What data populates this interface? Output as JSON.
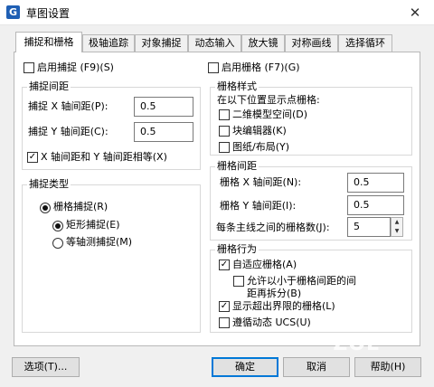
{
  "window": {
    "title": "草图设置",
    "app_icon": "G",
    "close_glyph": "✕"
  },
  "tabs": [
    {
      "label": "捕捉和栅格"
    },
    {
      "label": "极轴追踪"
    },
    {
      "label": "对象捕捉"
    },
    {
      "label": "动态输入"
    },
    {
      "label": "放大镜"
    },
    {
      "label": "对称画线"
    },
    {
      "label": "选择循环"
    }
  ],
  "snap": {
    "enable_label": "启用捕捉 (F9)(S)",
    "enable_checked": false,
    "spacing_group": "捕捉间距",
    "x_label": "捕捉 X 轴间距(P):",
    "x_value": "0.5",
    "y_label": "捕捉 Y 轴间距(C):",
    "y_value": "0.5",
    "equal_label": "X 轴间距和 Y 轴间距相等(X)",
    "equal_checked": true,
    "type_group": "捕捉类型",
    "grid_snap_label": "栅格捕捉(R)",
    "rect_snap_label": "矩形捕捉(E)",
    "iso_snap_label": "等轴测捕捉(M)",
    "selected_type": "矩形捕捉"
  },
  "grid": {
    "enable_label": "启用栅格 (F7)(G)",
    "enable_checked": false,
    "style_group": "栅格样式",
    "style_desc": "在以下位置显示点栅格:",
    "style_2d_label": "二维模型空间(D)",
    "style_block_label": "块编辑器(K)",
    "style_sheet_label": "图纸/布局(Y)",
    "spacing_group": "栅格间距",
    "x_label": "栅格 X 轴间距(N):",
    "x_value": "0.5",
    "y_label": "栅格 Y 轴间距(I):",
    "y_value": "0.5",
    "major_label": "每条主线之间的栅格数(J):",
    "major_value": "5",
    "behavior_group": "栅格行为",
    "adaptive_label": "自适应栅格(A)",
    "adaptive_checked": true,
    "subdivide_label_1": "允许以小于栅格间距的间",
    "subdivide_label_2": "距再拆分(B)",
    "subdivide_checked": false,
    "beyond_label": "显示超出界限的栅格(L)",
    "beyond_checked": true,
    "follow_ucs_label": "遵循动态 UCS(U)",
    "follow_ucs_checked": false
  },
  "buttons": {
    "options": "选项(T)...",
    "ok": "确定",
    "cancel": "取消",
    "help": "帮助(H)"
  },
  "watermark": "ZOL"
}
